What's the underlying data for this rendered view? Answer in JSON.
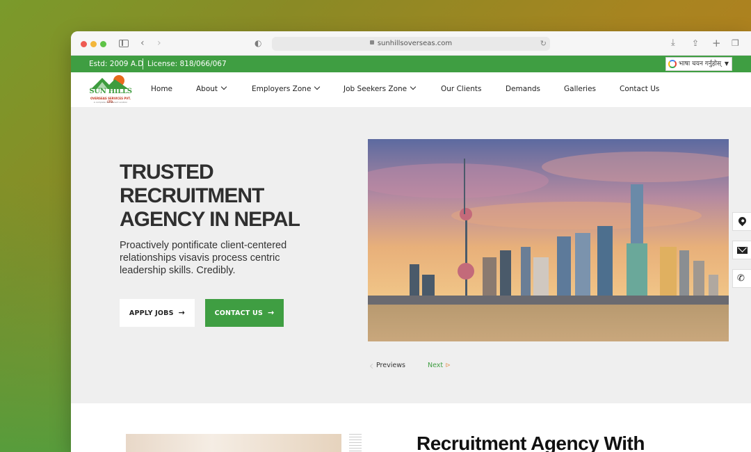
{
  "browser": {
    "url": "sunhillsoverseas.com"
  },
  "topbar": {
    "estd": "Estd: 2009 A.D",
    "license": "License: 818/066/067",
    "translate_label": "भाषा चयन गर्नुहोस्"
  },
  "logo": {
    "name": "SUN HILLS",
    "subtitle": "OVERSEAS SERVICES PVT. LTD.",
    "tagline": "A complete recruitment solution"
  },
  "nav": {
    "items": [
      {
        "label": "Home"
      },
      {
        "label": "About"
      },
      {
        "label": "Employers Zone"
      },
      {
        "label": "Job Seekers Zone"
      },
      {
        "label": "Our Clients"
      },
      {
        "label": "Demands"
      },
      {
        "label": "Galleries"
      },
      {
        "label": "Contact Us"
      }
    ]
  },
  "hero": {
    "title": "TRUSTED RECRUITMENT AGENCY IN NEPAL",
    "text": "Proactively pontificate client-centered relationships visavis process centric leadership skills. Credibly.",
    "apply_label": "APPLY JOBS",
    "contact_label": "CONTACT US",
    "prev_label": "Previews",
    "next_label": "Next"
  },
  "section": {
    "title": "Recruitment Agency With"
  },
  "colors": {
    "brand_green": "#3f9e42",
    "title_dark": "#2f2f2f"
  }
}
